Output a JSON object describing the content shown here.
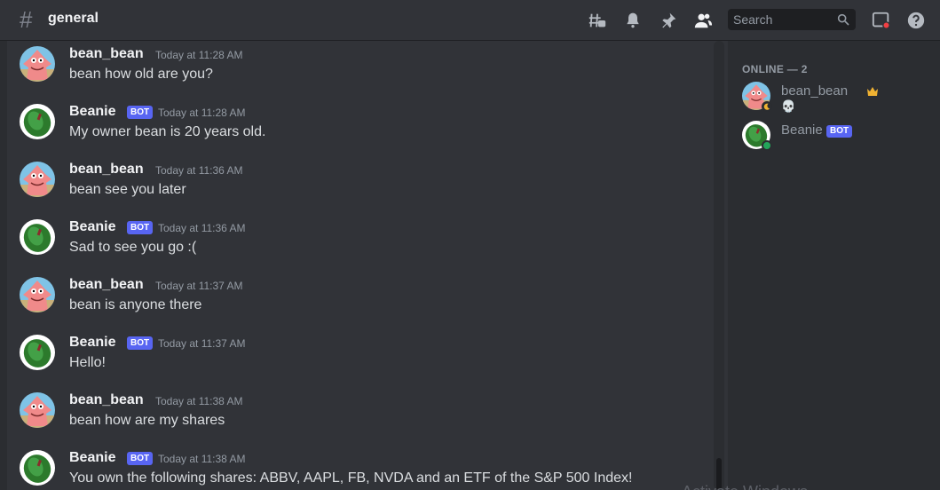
{
  "header": {
    "channel_name": "general",
    "search_placeholder": "Search"
  },
  "colors": {
    "accent": "#5865f2",
    "online": "#23a55a",
    "idle": "#f0b232",
    "crown": "#f0b232"
  },
  "messages": [
    {
      "author": "bean_bean",
      "is_bot": false,
      "time": "Today at 11:28 AM",
      "text": "bean how old are you?"
    },
    {
      "author": "Beanie",
      "is_bot": true,
      "bot_label": "BOT",
      "time": "Today at 11:28 AM",
      "text": "My owner bean is 20 years old."
    },
    {
      "author": "bean_bean",
      "is_bot": false,
      "time": "Today at 11:36 AM",
      "text": "bean see you later"
    },
    {
      "author": "Beanie",
      "is_bot": true,
      "bot_label": "BOT",
      "time": "Today at 11:36 AM",
      "text": "Sad to see you go :("
    },
    {
      "author": "bean_bean",
      "is_bot": false,
      "time": "Today at 11:37 AM",
      "text": "bean is anyone there"
    },
    {
      "author": "Beanie",
      "is_bot": true,
      "bot_label": "BOT",
      "time": "Today at 11:37 AM",
      "text": "Hello!"
    },
    {
      "author": "bean_bean",
      "is_bot": false,
      "time": "Today at 11:38 AM",
      "text": "bean how are my shares"
    },
    {
      "author": "Beanie",
      "is_bot": true,
      "bot_label": "BOT",
      "time": "Today at 11:38 AM",
      "text": "You own the following shares: ABBV, AAPL, FB, NVDA and an ETF of the S&P 500 Index!"
    }
  ],
  "members": {
    "header": "ONLINE — 2",
    "list": [
      {
        "name": "bean_bean",
        "status": "idle",
        "crown": true,
        "custom_status": "💀"
      },
      {
        "name": "Beanie",
        "status": "online",
        "bot_label": "BOT"
      }
    ]
  },
  "watermark": "Activate Windows"
}
